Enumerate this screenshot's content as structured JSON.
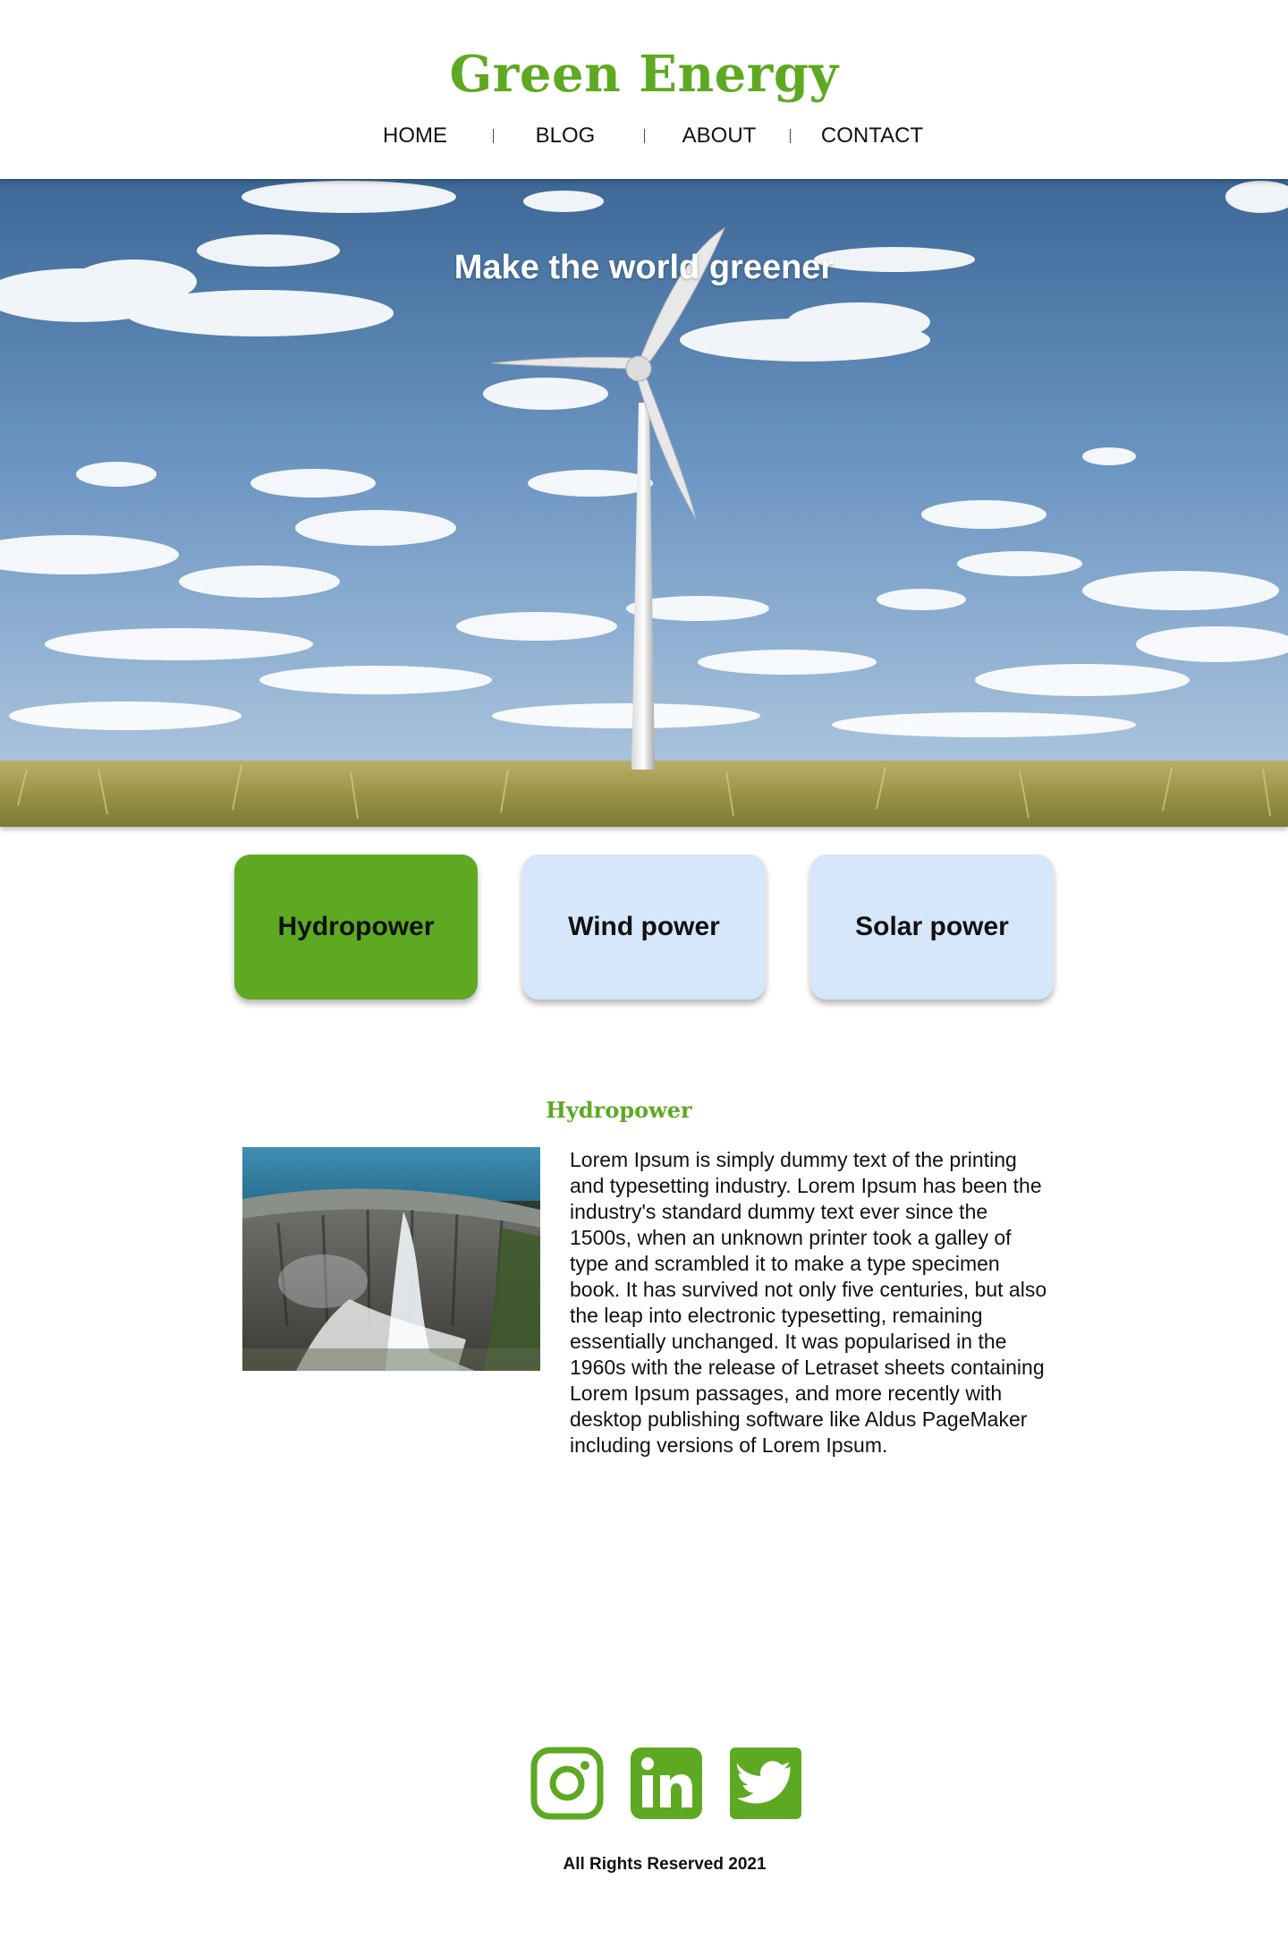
{
  "brand": {
    "name": "Green Energy"
  },
  "nav": {
    "items": [
      "HOME",
      "BLOG",
      "ABOUT",
      "CONTACT"
    ]
  },
  "hero": {
    "title": "Make the world greener"
  },
  "tabs": [
    {
      "label": "Hydropower",
      "active": true
    },
    {
      "label": "Wind power",
      "active": false
    },
    {
      "label": "Solar power",
      "active": false
    }
  ],
  "section": {
    "heading": "Hydropower",
    "body": "Lorem Ipsum is simply dummy text of the printing and typesetting industry. Lorem Ipsum has been the industry's standard dummy text ever since the 1500s, when an unknown printer took a galley of type and scrambled it to make a type specimen book. It has survived not only five centuries, but also the leap into electronic typesetting, remaining essentially unchanged. It was popularised in the 1960s with the release of Letraset sheets containing Lorem Ipsum passages, and more recently with desktop publishing software like Aldus PageMaker including versions of Lorem Ipsum."
  },
  "footer": {
    "social": [
      "instagram-icon",
      "linkedin-icon",
      "twitter-icon"
    ],
    "copyright": "All Rights Reserved 2021"
  },
  "colors": {
    "accent": "#5ea922",
    "tab_inactive": "#d6e7fb",
    "text": "#111111"
  }
}
